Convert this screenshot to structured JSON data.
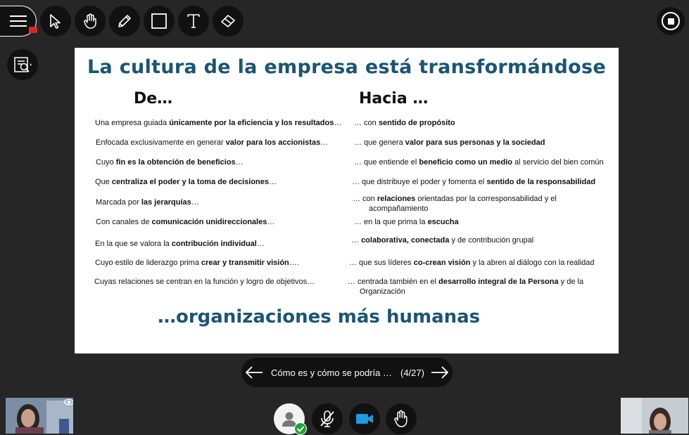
{
  "toolbar": {
    "items": [
      {
        "name": "menu-icon"
      },
      {
        "name": "pointer-icon"
      },
      {
        "name": "hand-icon"
      },
      {
        "name": "pencil-icon"
      },
      {
        "name": "rectangle-icon"
      },
      {
        "name": "text-icon"
      },
      {
        "name": "eraser-icon"
      }
    ],
    "record_color": "#d9262c"
  },
  "slide": {
    "title": "La cultura de la empresa está transformándose",
    "col_from": "De…",
    "col_to": "Hacia …",
    "footer": "…organizaciones más humanas",
    "accent": "#1b5573",
    "rows_from": [
      [
        [
          "Una empresa ",
          ""
        ],
        [
          "guiada ",
          ""
        ],
        [
          "únicamente por la eficiencia y los resultados",
          "b"
        ],
        [
          "…",
          ""
        ]
      ],
      [
        [
          "Enfocada exclusivamente en generar ",
          ""
        ],
        [
          "valor para los accionistas",
          "b"
        ],
        [
          "…",
          ""
        ]
      ],
      [
        [
          "Cuyo ",
          ""
        ],
        [
          "fin es la obtención de beneficios",
          "b"
        ],
        [
          "…",
          ""
        ]
      ],
      [
        [
          "Que ",
          ""
        ],
        [
          "centraliza el poder y la toma de decisiones",
          "b"
        ],
        [
          "…",
          ""
        ]
      ],
      [
        [
          "Marcada por ",
          ""
        ],
        [
          "las jerarquías",
          "b"
        ],
        [
          "…",
          ""
        ]
      ],
      [
        [
          "Con canales de ",
          ""
        ],
        [
          "comunicación unidireccionales",
          "b"
        ],
        [
          "…",
          ""
        ]
      ],
      [
        [
          "En la que se valora la ",
          ""
        ],
        [
          "contribución individual",
          "b"
        ],
        [
          "…",
          ""
        ]
      ],
      [
        [
          "Cuyo estilo de liderazgo prima ",
          ""
        ],
        [
          "crear y transmitir visión",
          "b"
        ],
        [
          "….",
          ""
        ]
      ],
      [
        [
          "Cuyas relaciones se centran en la función y logro de objetivos…",
          ""
        ]
      ]
    ],
    "rows_to": [
      [
        [
          "… con ",
          ""
        ],
        [
          "sentido de propósito",
          "b"
        ]
      ],
      [
        [
          "… que genera ",
          ""
        ],
        [
          "valor para sus personas y la sociedad",
          "b"
        ]
      ],
      [
        [
          "… que entiende el ",
          ""
        ],
        [
          "beneficio como un medio",
          "b"
        ],
        [
          " al servicio del bien común",
          ""
        ]
      ],
      [
        [
          "… que distribuye el poder y fomenta el ",
          ""
        ],
        [
          "sentido de la responsabilidad",
          "b"
        ]
      ],
      [
        [
          "… con ",
          ""
        ],
        [
          "relaciones",
          "b"
        ],
        [
          " orientadas por la corresponsabilidad y el",
          ""
        ]
      ],
      [
        [
          "… en la que prima la ",
          ""
        ],
        [
          "escucha",
          "b"
        ]
      ],
      [
        [
          "… ",
          ""
        ],
        [
          "colaborativa, conectada",
          "b"
        ],
        [
          " y de contribución grupal",
          ""
        ]
      ],
      [
        [
          "… que sus líderes ",
          ""
        ],
        [
          "co-crean visión",
          "b"
        ],
        [
          " y la abren al diálogo con la realidad",
          ""
        ]
      ],
      [
        [
          "… centrada también en el ",
          ""
        ],
        [
          "desarrollo integral de la Persona",
          "b"
        ],
        [
          " y de la",
          ""
        ]
      ]
    ],
    "rows_to_continuation": [
      "acompañamiento",
      "Organización"
    ]
  },
  "nav": {
    "title": "Cómo es y cómo se podría …",
    "page": "(4/27)"
  },
  "bottom_controls": [
    {
      "name": "user-avatar-icon"
    },
    {
      "name": "microphone-muted-icon"
    },
    {
      "name": "camera-icon"
    },
    {
      "name": "raise-hand-icon"
    }
  ],
  "status_color": "#21a336",
  "camera_color": "#1f9be0"
}
